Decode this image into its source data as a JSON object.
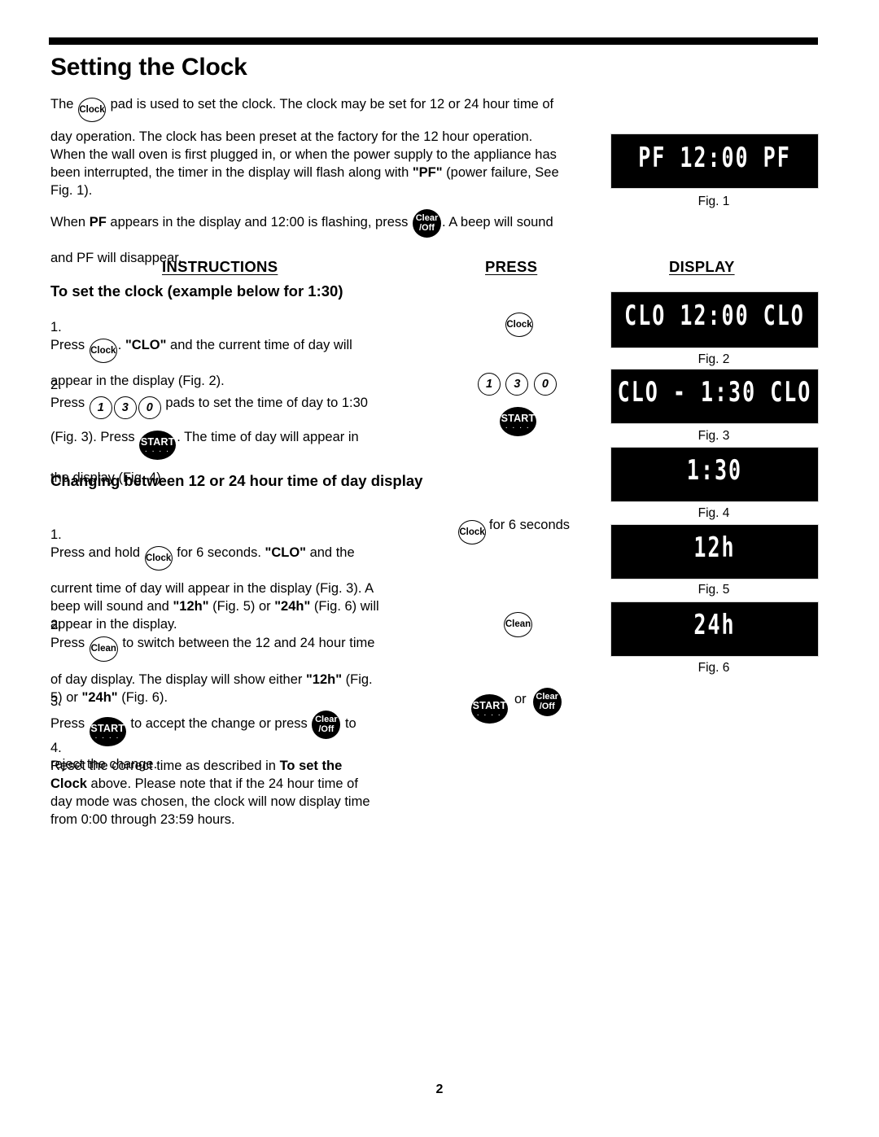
{
  "page": {
    "title": "Setting the Clock",
    "number": "2"
  },
  "intro": {
    "line1a": "The",
    "line1b": "pad is used to set the clock. The clock may be set for 12 or 24 hour time of",
    "line2": "day operation. The clock has been preset at the factory for the 12 hour operation.",
    "line3": "When the wall oven is first plugged in, or when the power supply to the appliance has",
    "line4a": "been interrupted, the timer in the display will flash along with",
    "line4b": "\"PF\"",
    "line4c": "(power failure, See",
    "line5": "Fig. 1)."
  },
  "para2": {
    "line1a": "When",
    "line1b": "PF",
    "line1c": "appears in the display and 12:00 is flashing, press",
    "line1d": ". A beep will sound",
    "line2": "and  PF will disappear."
  },
  "headers": {
    "instructions": "INSTRUCTIONS",
    "press": "PRESS",
    "display": "DISPLAY"
  },
  "sections": {
    "set_clock": "To set the clock (example below for 1:30)",
    "changing": "Changing between 12 or 24 hour time of day display"
  },
  "steps_set_clock": [
    {
      "num": "1.",
      "l1a": "Press",
      "l1b": ".",
      "l1c": "\"CLO\"",
      "l1d": "and the current time of day will",
      "l2": "appear in the display (Fig. 2)."
    },
    {
      "num": "2.",
      "l1a": "Press",
      "l1b": "pads to set the time of day to 1:30",
      "l2a": "(Fig. 3). Press",
      "l2b": ". The time of day will appear in",
      "l3": "the display (Fig. 4)."
    }
  ],
  "steps_changing": [
    {
      "num": "1.",
      "l1a": "Press and hold",
      "l1b": "for 6 seconds.",
      "l1c": "\"CLO\"",
      "l1d": "and the",
      "l2": "current time of day will appear in the display (Fig. 3). A",
      "l3a": "beep will sound and",
      "l3b": "\"12h\"",
      "l3c": "(Fig. 5) or",
      "l3d": "\"24h\"",
      "l3e": "(Fig. 6) will",
      "l4": "appear in the display."
    },
    {
      "num": "2.",
      "l1a": "Press",
      "l1b": "to switch between the 12 and 24 hour time",
      "l2a": "of day display. The display will show either",
      "l2b": "\"12h\"",
      "l2c": "(Fig.",
      "l3a": "5) or",
      "l3b": "\"24h\"",
      "l3c": "(Fig. 6)."
    },
    {
      "num": "3.",
      "l1a": "Press",
      "l1b": "to accept the change or press",
      "l1c": "to",
      "l2": "reject the change."
    },
    {
      "num": "4.",
      "l1a": "Reset the correct time as described in",
      "l1b": "To set the",
      "l2a": "Clock",
      "l2b": "above. Please note that if the 24 hour time of",
      "l3": "day mode was chosen, the clock will now display time",
      "l4": "from 0:00 through 23:59 hours."
    }
  ],
  "pads": {
    "clock": "Clock",
    "clean": "Clean",
    "start": "START",
    "start_dots": "· · · ·",
    "clear_line1": "Clear",
    "clear_line2": "/Off",
    "one": "1",
    "three": "3",
    "zero": "0",
    "hold_label": "for 6 seconds",
    "or_label": "or"
  },
  "displays": [
    {
      "id": "fig1",
      "text": "PF 12:00 PF",
      "label": "Fig. 1"
    },
    {
      "id": "fig2",
      "text": "CLO 12:00 CLO",
      "label": "Fig. 2"
    },
    {
      "id": "fig3",
      "text": "CLO - 1:30 CLO",
      "label": "Fig. 3"
    },
    {
      "id": "fig4",
      "text": "1:30",
      "label": "Fig. 4"
    },
    {
      "id": "fig5",
      "text": "12h",
      "label": "Fig. 5"
    },
    {
      "id": "fig6",
      "text": "24h",
      "label": "Fig. 6"
    }
  ],
  "colors": {
    "ink": "#000000",
    "paper": "#ffffff",
    "display_bg": "#000000",
    "display_text": "#ffffff"
  }
}
